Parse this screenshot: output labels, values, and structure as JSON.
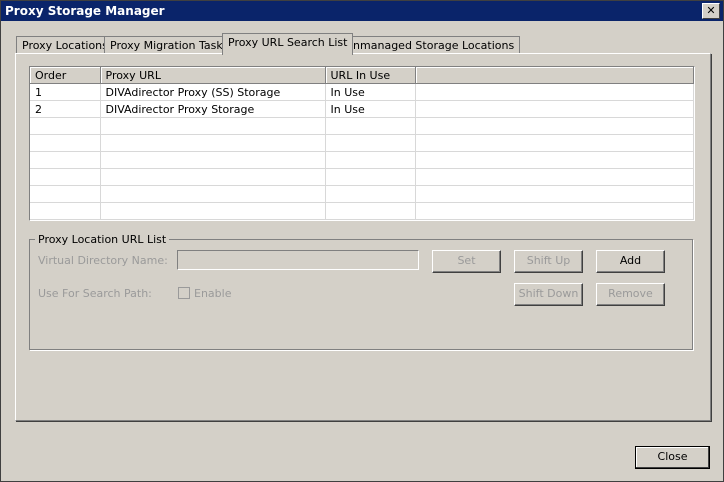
{
  "window": {
    "title": "Proxy Storage Manager",
    "close_glyph": "✕"
  },
  "tabs": [
    {
      "label": "Proxy Locations",
      "active": false
    },
    {
      "label": "Proxy Migration Tasks",
      "active": false
    },
    {
      "label": "Proxy URL Search List",
      "active": true
    },
    {
      "label": "Unmanaged Storage Locations",
      "active": false
    }
  ],
  "grid": {
    "columns": [
      "Order",
      "Proxy URL",
      "URL In Use",
      ""
    ],
    "rows": [
      [
        "1",
        "DIVAdirector Proxy (SS) Storage",
        "In Use",
        ""
      ],
      [
        "2",
        "DIVAdirector Proxy Storage",
        "In Use",
        ""
      ]
    ]
  },
  "group": {
    "title": "Proxy Location URL List",
    "virtual_directory_label": "Virtual Directory Name:",
    "virtual_directory_value": "",
    "search_path_label": "Use For Search Path:",
    "enable_label": "Enable",
    "buttons": {
      "set": "Set",
      "shift_up": "Shift Up",
      "add": "Add",
      "shift_down": "Shift Down",
      "remove": "Remove"
    }
  },
  "footer": {
    "close_label": "Close"
  }
}
